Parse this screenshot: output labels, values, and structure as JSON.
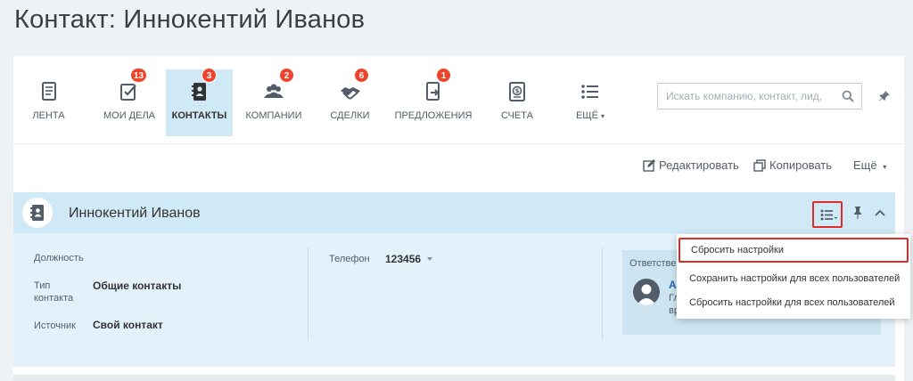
{
  "page": {
    "title": "Контакт: Иннокентий Иванов"
  },
  "nav": {
    "items": [
      {
        "label": "ЛЕНТА",
        "icon": "feed-icon",
        "badge": ""
      },
      {
        "label": "МОИ ДЕЛА",
        "icon": "tasks-icon",
        "badge": "13"
      },
      {
        "label": "КОНТАКТЫ",
        "icon": "contacts-icon",
        "badge": "3",
        "active": true
      },
      {
        "label": "КОМПАНИИ",
        "icon": "companies-icon",
        "badge": "2"
      },
      {
        "label": "СДЕЛКИ",
        "icon": "deals-icon",
        "badge": "6"
      },
      {
        "label": "ПРЕДЛОЖЕНИЯ",
        "icon": "offers-icon",
        "badge": "1"
      },
      {
        "label": "СЧЕТА",
        "icon": "invoices-icon",
        "badge": ""
      },
      {
        "label": "ЕЩЁ",
        "icon": "more-list-icon",
        "badge": ""
      }
    ]
  },
  "search": {
    "placeholder": "Искать компанию, контакт, лид,",
    "value": ""
  },
  "toolbar": {
    "edit_label": "Редактировать",
    "copy_label": "Копировать",
    "more_label": "Ещё"
  },
  "entity": {
    "name": "Иннокентий Иванов",
    "fields": {
      "position_label": "Должность",
      "type_label_1": "Тип",
      "type_label_2": "контакта",
      "type_value": "Общие контакты",
      "source_label": "Источник",
      "source_value": "Свой контакт",
      "phone_label": "Телефон",
      "phone_value": "123456"
    },
    "responsible": {
      "label": "Ответстве",
      "name": "А",
      "line1": "Гл",
      "line2": "вр"
    }
  },
  "menu": {
    "items": [
      "Сбросить настройки",
      "Сохранить настройки для всех пользователей",
      "Сбросить настройки для всех пользователей"
    ]
  },
  "colors": {
    "accent": "#cfe9f6",
    "badge": "#f0432b",
    "highlight": "#e02a2a",
    "link": "#2067b0"
  }
}
